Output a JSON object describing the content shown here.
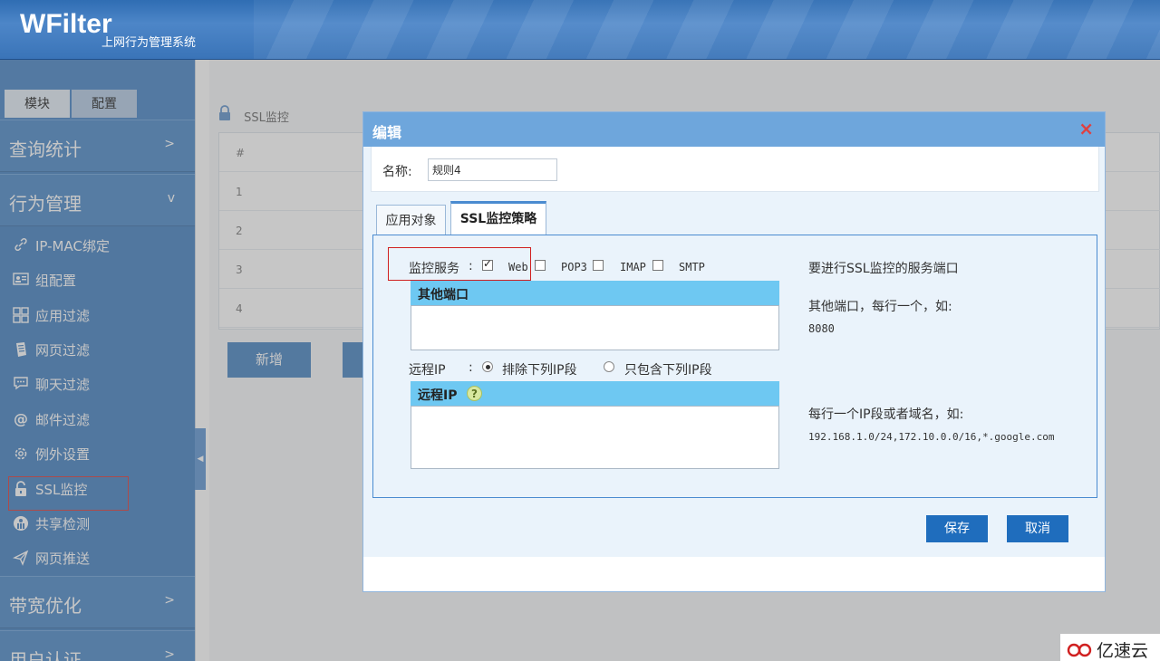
{
  "app": {
    "logo": "WFilter",
    "subtitle": "上网行为管理系统"
  },
  "sidebar": {
    "tabs": [
      {
        "label": "模块"
      },
      {
        "label": "配置"
      }
    ],
    "groups": [
      {
        "label": "查询统计",
        "arrow": ">"
      },
      {
        "label": "行为管理",
        "arrow": "v"
      },
      {
        "label": "带宽优化",
        "arrow": ">"
      },
      {
        "label": "用户认证",
        "arrow": ">"
      }
    ],
    "items": [
      {
        "label": "IP-MAC绑定",
        "icon": "link-icon"
      },
      {
        "label": "组配置",
        "icon": "id-card-icon"
      },
      {
        "label": "应用过滤",
        "icon": "grid-icon"
      },
      {
        "label": "网页过滤",
        "icon": "web-icon"
      },
      {
        "label": "聊天过滤",
        "icon": "chat-icon"
      },
      {
        "label": "邮件过滤",
        "icon": "at-icon"
      },
      {
        "label": "例外设置",
        "icon": "gear-icon"
      },
      {
        "label": "SSL监控",
        "icon": "lock-icon",
        "selected": true
      },
      {
        "label": "共享检测",
        "icon": "share-icon"
      },
      {
        "label": "网页推送",
        "icon": "send-icon"
      }
    ]
  },
  "main": {
    "title": "SSL监控",
    "grid": {
      "header": "#",
      "rows": [
        "1",
        "2",
        "3",
        "4"
      ]
    },
    "new_button": "新增"
  },
  "dialog": {
    "title": "编辑",
    "close": "×",
    "name_label": "名称:",
    "name_value": "规则4",
    "tabs": [
      {
        "label": "应用对象"
      },
      {
        "label": "SSL监控策略",
        "active": true
      }
    ],
    "monitor_service": {
      "label": "监控服务",
      "colon": ":",
      "options": [
        {
          "label": "Web",
          "checked": true
        },
        {
          "label": "POP3",
          "checked": false
        },
        {
          "label": "IMAP",
          "checked": false
        },
        {
          "label": "SMTP",
          "checked": false
        }
      ]
    },
    "other_ports": {
      "header": "其他端口",
      "value": ""
    },
    "remote_ip": {
      "label": "远程IP",
      "colon": ":",
      "options": [
        {
          "label": "排除下列IP段",
          "selected": true
        },
        {
          "label": "只包含下列IP段",
          "selected": false
        }
      ],
      "header": "远程IP",
      "help": "?",
      "value": ""
    },
    "help_text": {
      "ports_title": "要进行SSL监控的服务端口",
      "ports_hint": "其他端口，每行一个，如:",
      "ports_example": "8080",
      "ip_hint": "每行一个IP段或者域名，如:",
      "ip_example": "192.168.1.0/24,172.10.0.0/16,*.google.com"
    },
    "save_button": "保存",
    "cancel_button": "取消"
  },
  "watermark": {
    "text": "亿速云"
  },
  "colors": {
    "accent": "#1f6dbd",
    "sidebar": "#2a6fb8",
    "dialog_header": "#6ea6dc",
    "section_header": "#6ec8f2",
    "highlight": "#d02020"
  }
}
